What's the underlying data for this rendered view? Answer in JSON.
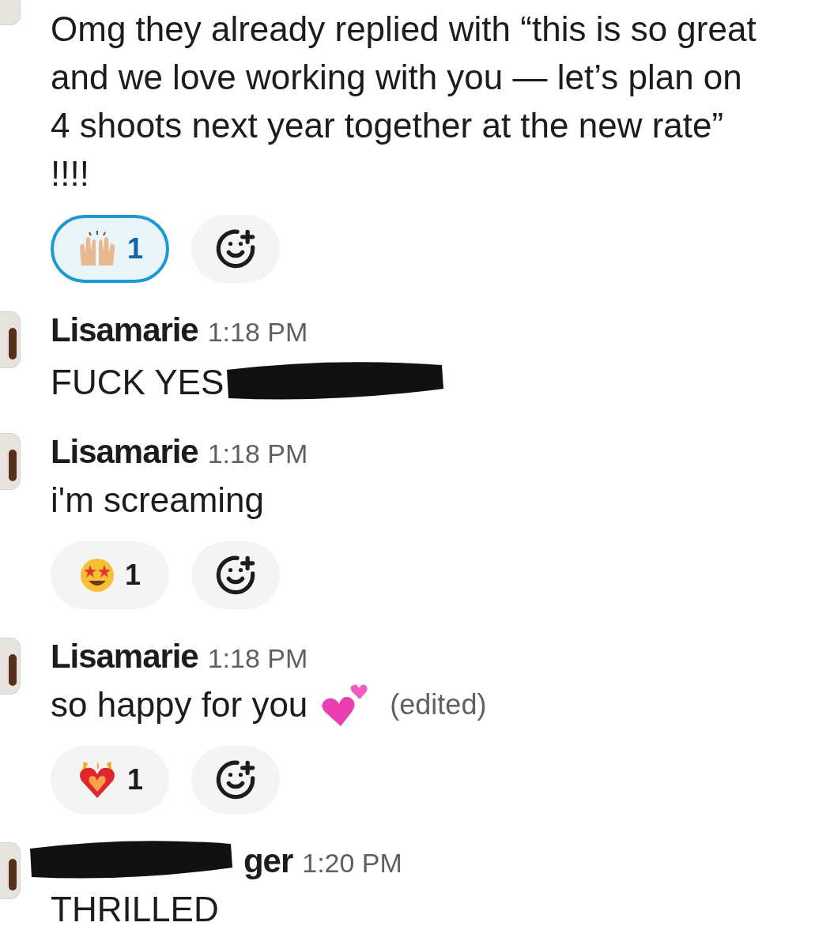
{
  "messages": [
    {
      "text": "Omg they already replied with “this is so great and we love working with you — let’s plan on 4 shoots next year together at the new rate” !!!!",
      "reactions": [
        {
          "kind": "raised-hands",
          "count": "1",
          "selected": true
        }
      ]
    },
    {
      "author": "Lisamarie",
      "time": "1:18 PM",
      "text": "FUCK YES",
      "redacted": true
    },
    {
      "author": "Lisamarie",
      "time": "1:18 PM",
      "text": "i'm screaming",
      "reactions": [
        {
          "kind": "star-eyes",
          "count": "1",
          "selected": false
        }
      ]
    },
    {
      "author": "Lisamarie",
      "time": "1:18 PM",
      "text": "so happy for you",
      "inline_emoji": {
        "kind": "two-hearts"
      },
      "edited": "(edited)",
      "reactions": [
        {
          "kind": "heart-on-fire",
          "count": "1",
          "selected": false
        }
      ]
    },
    {
      "author": "ger",
      "author_redacted": true,
      "time": "1:20 PM",
      "text": "THRILLED"
    }
  ]
}
